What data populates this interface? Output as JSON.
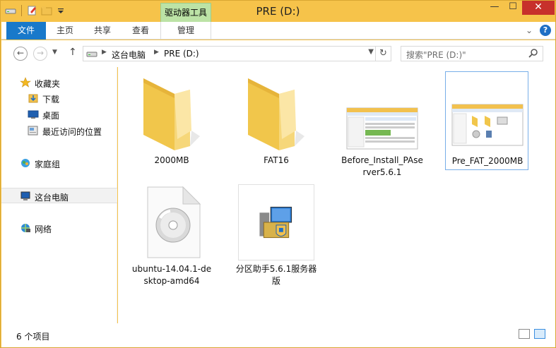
{
  "window": {
    "title": "PRE (D:)",
    "context_tab_header": "驱动器工具",
    "controls": {
      "minimize": "—",
      "maximize": "☐",
      "close": "✕"
    }
  },
  "ribbon": {
    "tabs": [
      {
        "label": "文件"
      },
      {
        "label": "主页"
      },
      {
        "label": "共享"
      },
      {
        "label": "查看"
      },
      {
        "label": "管理"
      }
    ],
    "collapse_glyph": "⌄",
    "help_glyph": "?"
  },
  "address": {
    "crumbs": [
      "这台电脑",
      "PRE (D:)"
    ],
    "separator": "▶",
    "search_placeholder": "搜索\"PRE (D:)\""
  },
  "navpane": {
    "items": [
      {
        "label": "收藏夹",
        "icon": "star-icon"
      },
      {
        "label": "下载",
        "icon": "download-folder-icon"
      },
      {
        "label": "桌面",
        "icon": "desktop-icon"
      },
      {
        "label": "最近访问的位置",
        "icon": "recent-places-icon"
      },
      {
        "label": "家庭组",
        "icon": "homegroup-icon"
      },
      {
        "label": "这台电脑",
        "icon": "computer-icon"
      },
      {
        "label": "网络",
        "icon": "network-icon"
      }
    ]
  },
  "files": [
    {
      "label": "2000MB",
      "type": "folder"
    },
    {
      "label": "FAT16",
      "type": "folder"
    },
    {
      "label": "Before_Install_PAserver5.6.1",
      "type": "image"
    },
    {
      "label": "Pre_FAT_2000MB",
      "type": "image"
    },
    {
      "label": "ubuntu-14.04.1-desktop-amd64",
      "type": "disc-image"
    },
    {
      "label": "分区助手5.6.1服务器版",
      "type": "installer"
    }
  ],
  "status": {
    "item_count": "6 个项目"
  },
  "colors": {
    "accent": "#1979ca",
    "context_tab": "#bce3a6",
    "close": "#c7302b",
    "window_frame": "#f6c34a"
  }
}
